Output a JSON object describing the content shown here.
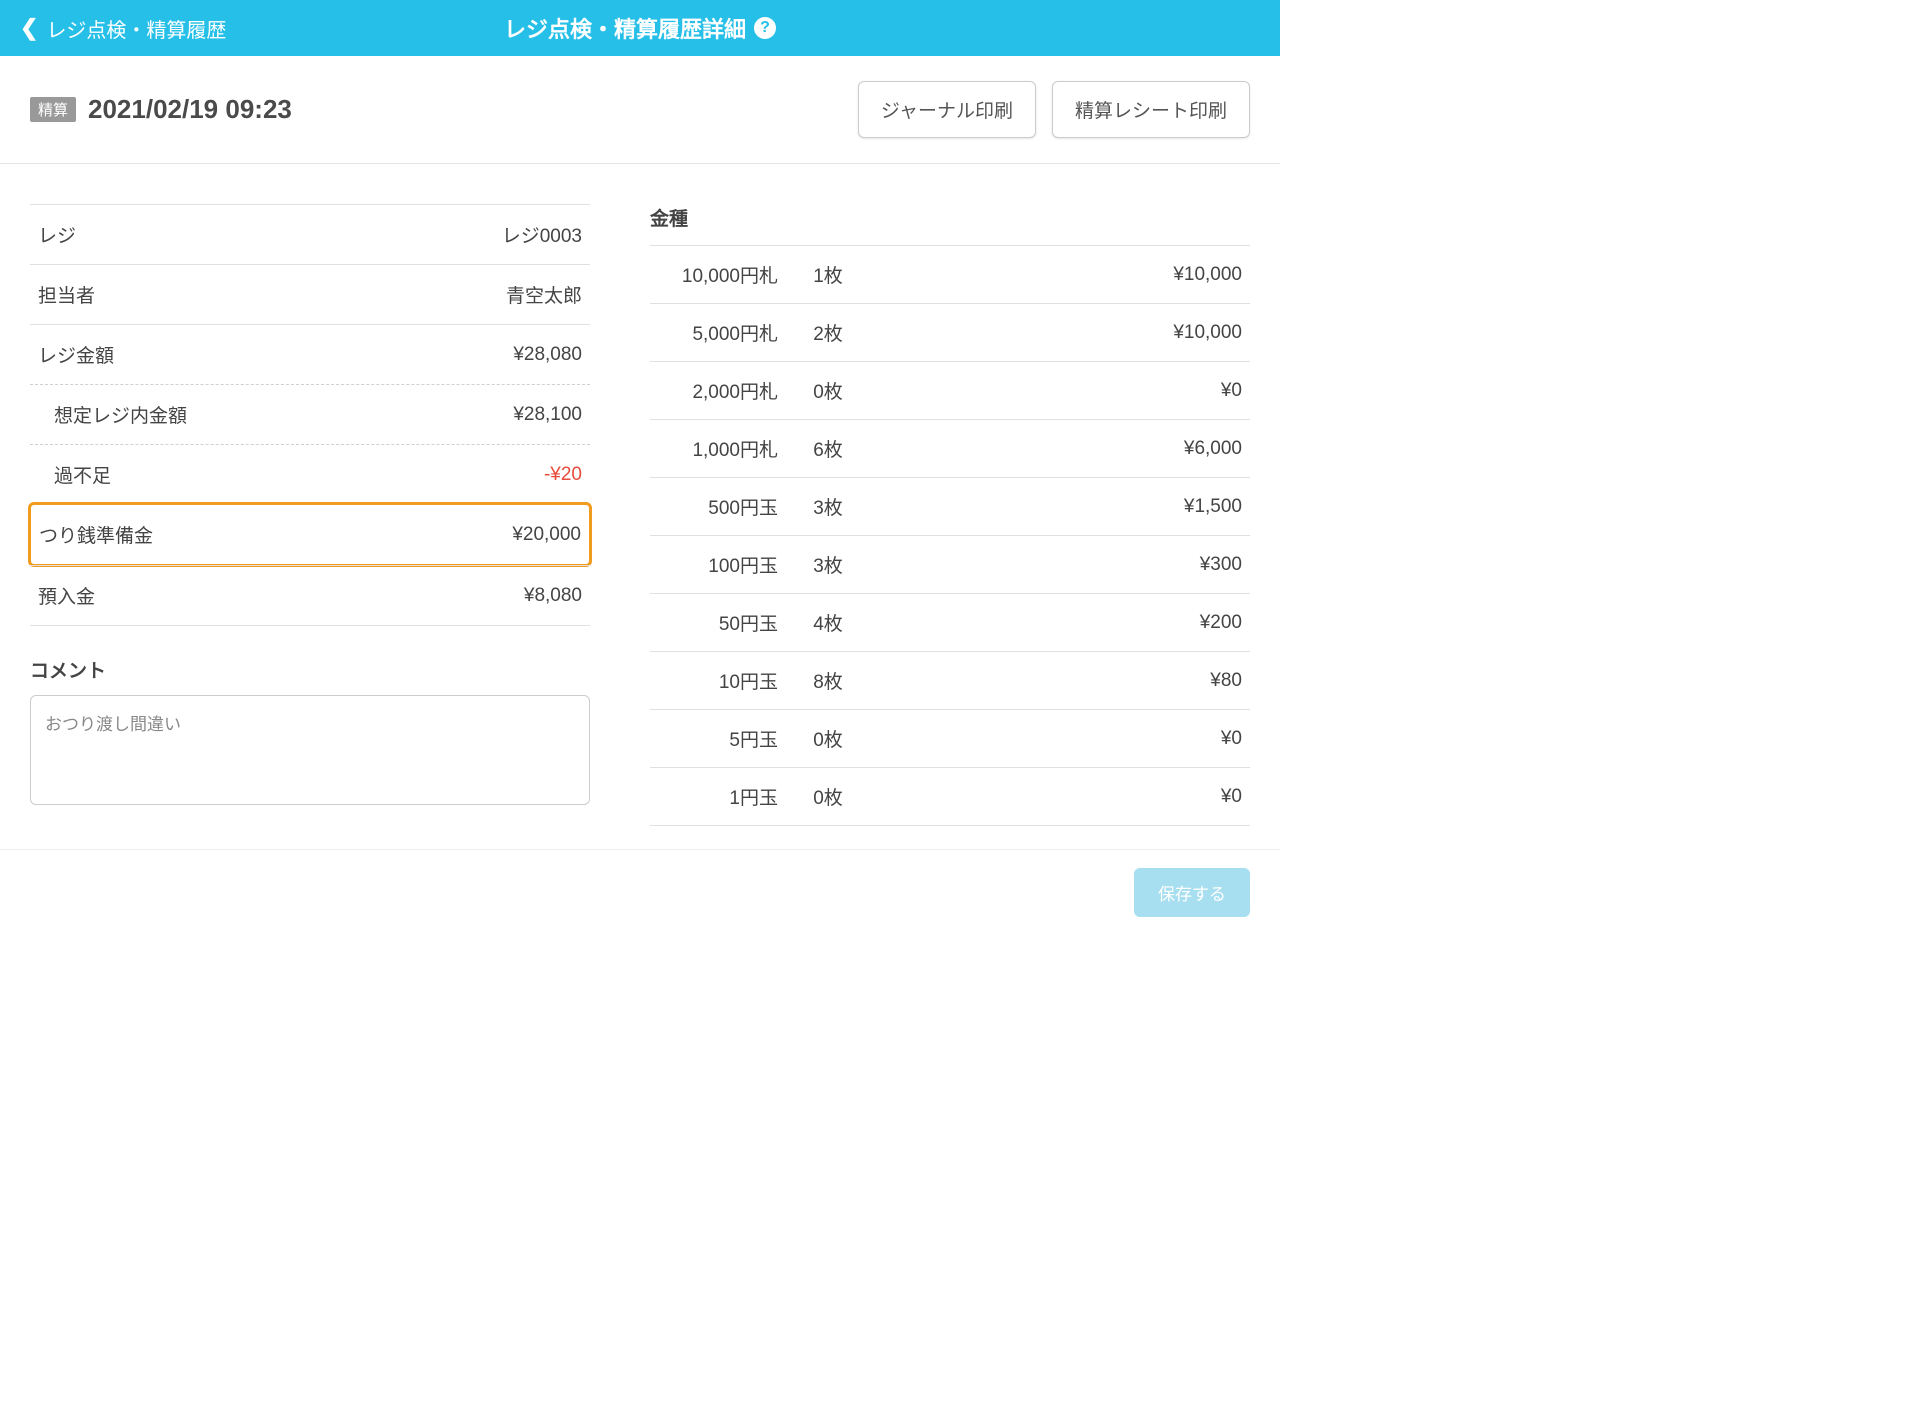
{
  "header": {
    "back_label": "レジ点検・精算履歴",
    "title": "レジ点検・精算履歴詳細"
  },
  "subheader": {
    "badge": "精算",
    "timestamp": "2021/02/19 09:23",
    "journal_print": "ジャーナル印刷",
    "receipt_print": "精算レシート印刷"
  },
  "info": {
    "register_label": "レジ",
    "register_value": "レジ0003",
    "staff_label": "担当者",
    "staff_value": "青空太郎",
    "register_amount_label": "レジ金額",
    "register_amount_value": "¥28,080",
    "expected_label": "想定レジ内金額",
    "expected_value": "¥28,100",
    "diff_label": "過不足",
    "diff_value": "-¥20",
    "change_fund_label": "つり銭準備金",
    "change_fund_value": "¥20,000",
    "deposit_label": "預入金",
    "deposit_value": "¥8,080"
  },
  "comment": {
    "label": "コメント",
    "value": "おつり渡し間違い"
  },
  "denom": {
    "title": "金種",
    "rows": [
      {
        "name": "10,000円札",
        "count": "1枚",
        "amount": "¥10,000"
      },
      {
        "name": "5,000円札",
        "count": "2枚",
        "amount": "¥10,000"
      },
      {
        "name": "2,000円札",
        "count": "0枚",
        "amount": "¥0"
      },
      {
        "name": "1,000円札",
        "count": "6枚",
        "amount": "¥6,000"
      },
      {
        "name": "500円玉",
        "count": "3枚",
        "amount": "¥1,500"
      },
      {
        "name": "100円玉",
        "count": "3枚",
        "amount": "¥300"
      },
      {
        "name": "50円玉",
        "count": "4枚",
        "amount": "¥200"
      },
      {
        "name": "10円玉",
        "count": "8枚",
        "amount": "¥80"
      },
      {
        "name": "5円玉",
        "count": "0枚",
        "amount": "¥0"
      },
      {
        "name": "1円玉",
        "count": "0枚",
        "amount": "¥0"
      }
    ]
  },
  "footer": {
    "save": "保存する"
  }
}
